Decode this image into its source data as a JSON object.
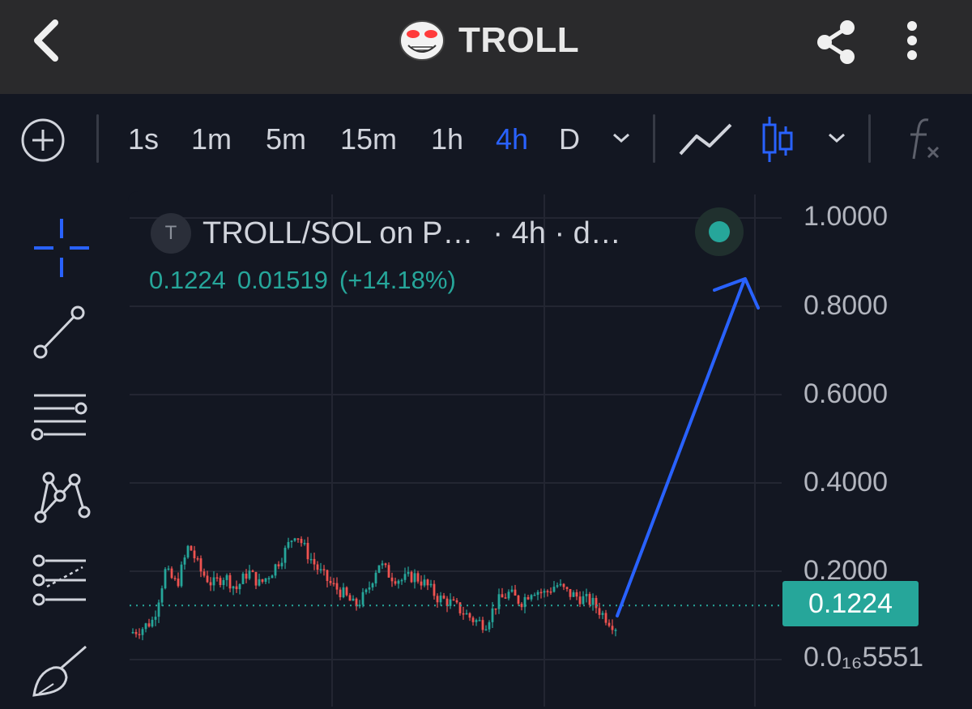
{
  "header": {
    "title": "TROLL",
    "back_icon": "chevron-left-icon",
    "share_icon": "share-icon",
    "more_icon": "more-vertical-icon"
  },
  "toolbar": {
    "timeframes": [
      "1s",
      "1m",
      "5m",
      "15m",
      "1h",
      "4h",
      "D"
    ],
    "active_timeframe": "4h",
    "add_icon": "plus-circle-icon",
    "line_chart_icon": "line-chart-icon",
    "candles_icon": "candlestick-icon",
    "indicators_icon": "function-icon"
  },
  "sidebar": {
    "tools": [
      "crosshair-icon",
      "trendline-icon",
      "fib-levels-icon",
      "pattern-icon",
      "projection-icon",
      "brush-icon"
    ]
  },
  "legend": {
    "badge": "T",
    "pair": "TROLL/SOL on P…",
    "meta": "· 4h · d…",
    "price": "0.1224",
    "change": "0.01519",
    "change_pct": "(+14.18%)"
  },
  "axis": {
    "labels": [
      "1.0000",
      "0.8000",
      "0.6000",
      "0.4000",
      "0.2000",
      "0.0₁₆5551"
    ],
    "current_price": "0.1224"
  },
  "colors": {
    "up": "#26a69a",
    "down": "#ef5350",
    "accent": "#2962ff",
    "background": "#131722"
  },
  "chart_data": {
    "type": "candlestick",
    "pair": "TROLL/SOL",
    "interval": "4h",
    "y_axis_ticks": [
      1.0,
      0.8,
      0.6,
      0.4,
      0.2
    ],
    "ylim": [
      0.0,
      1.05
    ],
    "last_price": 0.1224,
    "price_path": [
      0.06,
      0.07,
      0.09,
      0.2,
      0.17,
      0.26,
      0.2,
      0.17,
      0.19,
      0.16,
      0.2,
      0.17,
      0.2,
      0.24,
      0.29,
      0.24,
      0.2,
      0.17,
      0.15,
      0.12,
      0.15,
      0.22,
      0.19,
      0.18,
      0.19,
      0.17,
      0.14,
      0.13,
      0.11,
      0.09,
      0.08,
      0.13,
      0.15,
      0.13,
      0.16,
      0.15,
      0.17,
      0.15,
      0.14,
      0.13,
      0.1,
      0.075
    ],
    "annotation": "upward-arrow"
  }
}
